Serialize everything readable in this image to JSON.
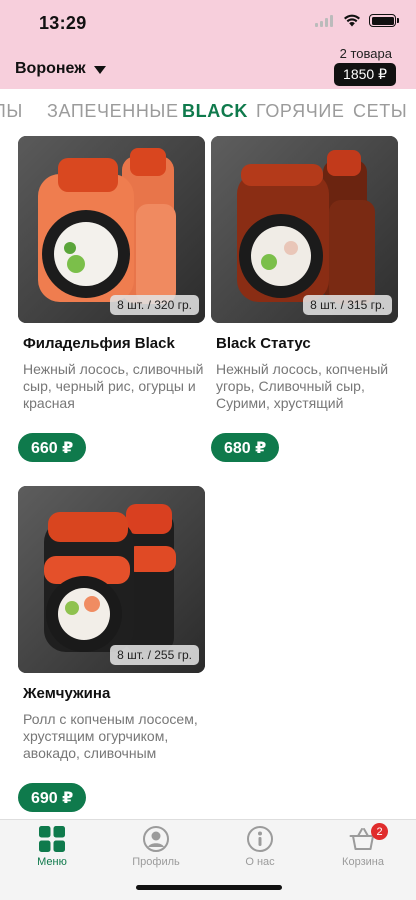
{
  "status_bar": {
    "time": "13:29"
  },
  "header": {
    "city": "Воронеж",
    "cart_count": "2 товара",
    "cart_total": "1850 ₽"
  },
  "tabs": [
    {
      "label": "ЛЫ",
      "active": false
    },
    {
      "label": "ЗАПЕЧЕННЫЕ",
      "active": false
    },
    {
      "label": "BLACK",
      "active": true
    },
    {
      "label": "ГОРЯЧИЕ",
      "active": false
    },
    {
      "label": "СЕТЫ",
      "active": false
    }
  ],
  "products": [
    {
      "title": "Филадельфия Black",
      "weight": "8 шт. / 320 гр.",
      "description": "Нежный лосось, сливочный сыр, черный рис, огурцы и красная",
      "price": "660 ₽"
    },
    {
      "title": "Black Статус",
      "weight": "8 шт. / 315 гр.",
      "description": "Нежный лосось, копченый угорь, Сливочный сыр, Сурими, хрустящий",
      "price": "680 ₽"
    },
    {
      "title": "Жемчужина",
      "weight": "8 шт. / 255 гр.",
      "description": "Ролл с копченым лососем, хрустящим огурчиком, авокадо, сливочным",
      "price": "690 ₽"
    }
  ],
  "bottom_nav": [
    {
      "label": "Меню",
      "icon": "grid-icon",
      "active": true
    },
    {
      "label": "Профиль",
      "icon": "profile-icon",
      "active": false
    },
    {
      "label": "О нас",
      "icon": "info-icon",
      "active": false
    },
    {
      "label": "Корзина",
      "icon": "basket-icon",
      "active": false,
      "badge": "2"
    }
  ],
  "colors": {
    "header_bg": "#f7cfdc",
    "accent": "#0f7a4c",
    "badge": "#e02c2c"
  }
}
